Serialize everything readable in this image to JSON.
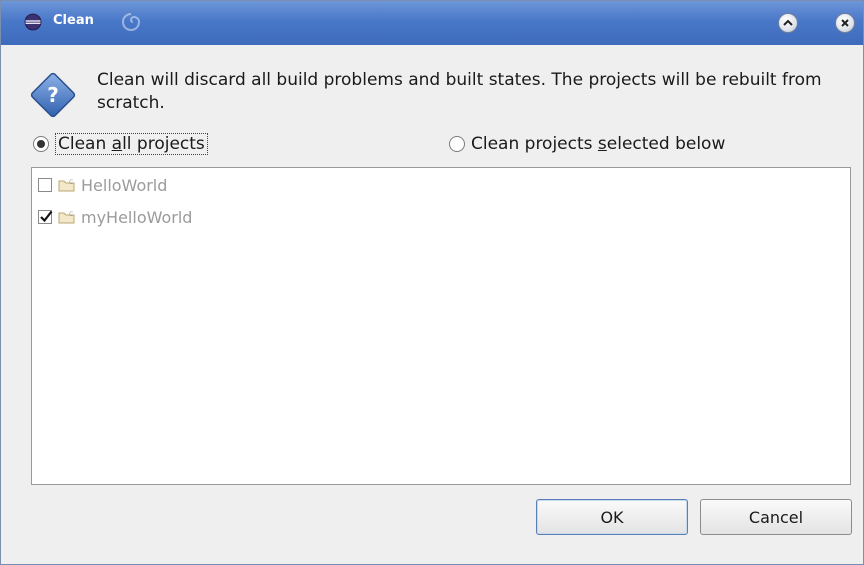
{
  "window": {
    "title": "Clean",
    "title_icon": "eclipse-icon",
    "decoration_icon": "swirl-icon",
    "controls": [
      "minimize-icon",
      "close-icon"
    ]
  },
  "message": {
    "icon": "question-icon",
    "text": "Clean will discard all build problems and built states.  The projects will be rebuilt from scratch."
  },
  "options": {
    "all": {
      "pre": "Clean ",
      "mnemonic": "a",
      "post": "ll projects",
      "selected": true
    },
    "selected": {
      "pre": "Clean projects ",
      "mnemonic": "s",
      "post": "elected below",
      "selected": false
    }
  },
  "projects": [
    {
      "name": "HelloWorld",
      "checked": false,
      "icon": "java-project-folder-icon"
    },
    {
      "name": "myHelloWorld",
      "checked": true,
      "icon": "java-project-folder-icon"
    }
  ],
  "buttons": {
    "ok": "OK",
    "cancel": "Cancel"
  },
  "colors": {
    "titlebar": "#4a78c9",
    "disabled_text": "#9b9b9b",
    "dialog_bg": "#efefef"
  }
}
